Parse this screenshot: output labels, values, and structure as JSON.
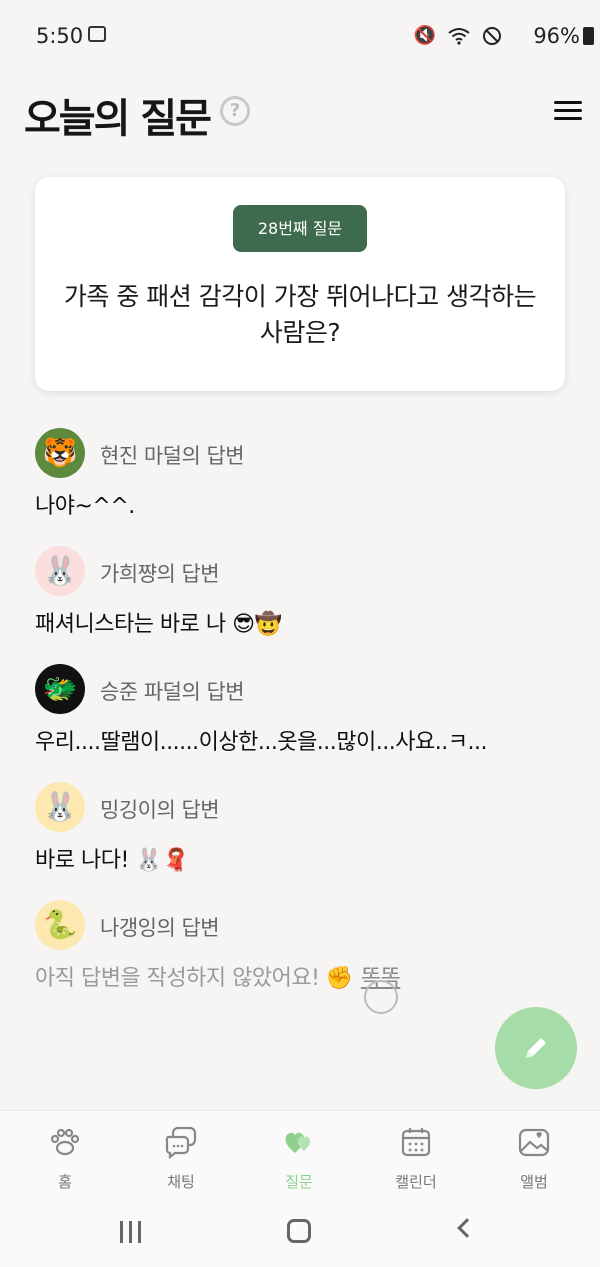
{
  "status_bar": {
    "time": "5:50",
    "battery": "96%",
    "icons": [
      "screenshot-icon",
      "mute-icon",
      "wifi-icon",
      "do-not-disturb-icon",
      "battery-icon"
    ]
  },
  "header": {
    "title": "오늘의 질문",
    "help_symbol": "?"
  },
  "question": {
    "badge": "28번째 질문",
    "text": "가족 중 패션 감각이 가장 뛰어나다고 생각하는 사람은?"
  },
  "answers": [
    {
      "author": "현진 마덜의 답변",
      "text": "나야~^^.",
      "avatar_emoji": "🐯",
      "avatar_bg": "#5d8a3c",
      "muted": false
    },
    {
      "author": "가희쨩의 답변",
      "text": "패셔니스타는 바로 나 😎🤠",
      "avatar_emoji": "🐰",
      "avatar_bg": "#fbdede",
      "muted": false
    },
    {
      "author": "승준 파덜의 답변",
      "text": "우리....딸램이......이상한...옷을...많이...사요..ㅋ...",
      "avatar_emoji": "🐲",
      "avatar_bg": "#111111",
      "muted": false
    },
    {
      "author": "밍깅이의 답변",
      "text": "바로 나다! 🐰🧣",
      "avatar_emoji": "🐰",
      "avatar_bg": "#fde9b0",
      "muted": false
    },
    {
      "author": "나갱잉의 답변",
      "text": "아직 답변을 작성하지 않았어요! ✊",
      "knock": "똑똑",
      "avatar_emoji": "🐍",
      "avatar_bg": "#fde9b0",
      "muted": true
    }
  ],
  "fab": {
    "icon": "pencil-icon"
  },
  "bottom_nav": [
    {
      "label": "홈",
      "icon": "paw-icon",
      "active": false
    },
    {
      "label": "채팅",
      "icon": "chat-icon",
      "active": false
    },
    {
      "label": "질문",
      "icon": "hearts-icon",
      "active": true
    },
    {
      "label": "캘린더",
      "icon": "calendar-icon",
      "active": false
    },
    {
      "label": "앨범",
      "icon": "album-icon",
      "active": false
    }
  ],
  "colors": {
    "accent_green": "#3e6b4e",
    "fab_green": "#a5dca7",
    "active_nav": "#8fd08f"
  }
}
